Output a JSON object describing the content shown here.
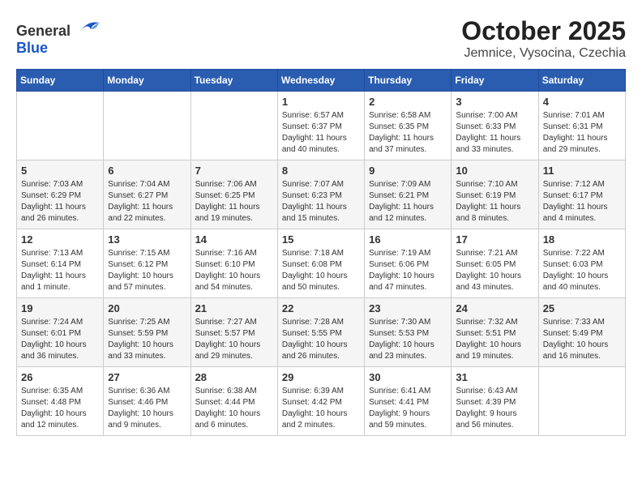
{
  "header": {
    "logo_general": "General",
    "logo_blue": "Blue",
    "month_title": "October 2025",
    "subtitle": "Jemnice, Vysocina, Czechia"
  },
  "weekdays": [
    "Sunday",
    "Monday",
    "Tuesday",
    "Wednesday",
    "Thursday",
    "Friday",
    "Saturday"
  ],
  "rows": [
    [
      {
        "day": "",
        "info": ""
      },
      {
        "day": "",
        "info": ""
      },
      {
        "day": "",
        "info": ""
      },
      {
        "day": "1",
        "info": "Sunrise: 6:57 AM\nSunset: 6:37 PM\nDaylight: 11 hours\nand 40 minutes."
      },
      {
        "day": "2",
        "info": "Sunrise: 6:58 AM\nSunset: 6:35 PM\nDaylight: 11 hours\nand 37 minutes."
      },
      {
        "day": "3",
        "info": "Sunrise: 7:00 AM\nSunset: 6:33 PM\nDaylight: 11 hours\nand 33 minutes."
      },
      {
        "day": "4",
        "info": "Sunrise: 7:01 AM\nSunset: 6:31 PM\nDaylight: 11 hours\nand 29 minutes."
      }
    ],
    [
      {
        "day": "5",
        "info": "Sunrise: 7:03 AM\nSunset: 6:29 PM\nDaylight: 11 hours\nand 26 minutes."
      },
      {
        "day": "6",
        "info": "Sunrise: 7:04 AM\nSunset: 6:27 PM\nDaylight: 11 hours\nand 22 minutes."
      },
      {
        "day": "7",
        "info": "Sunrise: 7:06 AM\nSunset: 6:25 PM\nDaylight: 11 hours\nand 19 minutes."
      },
      {
        "day": "8",
        "info": "Sunrise: 7:07 AM\nSunset: 6:23 PM\nDaylight: 11 hours\nand 15 minutes."
      },
      {
        "day": "9",
        "info": "Sunrise: 7:09 AM\nSunset: 6:21 PM\nDaylight: 11 hours\nand 12 minutes."
      },
      {
        "day": "10",
        "info": "Sunrise: 7:10 AM\nSunset: 6:19 PM\nDaylight: 11 hours\nand 8 minutes."
      },
      {
        "day": "11",
        "info": "Sunrise: 7:12 AM\nSunset: 6:17 PM\nDaylight: 11 hours\nand 4 minutes."
      }
    ],
    [
      {
        "day": "12",
        "info": "Sunrise: 7:13 AM\nSunset: 6:14 PM\nDaylight: 11 hours\nand 1 minute."
      },
      {
        "day": "13",
        "info": "Sunrise: 7:15 AM\nSunset: 6:12 PM\nDaylight: 10 hours\nand 57 minutes."
      },
      {
        "day": "14",
        "info": "Sunrise: 7:16 AM\nSunset: 6:10 PM\nDaylight: 10 hours\nand 54 minutes."
      },
      {
        "day": "15",
        "info": "Sunrise: 7:18 AM\nSunset: 6:08 PM\nDaylight: 10 hours\nand 50 minutes."
      },
      {
        "day": "16",
        "info": "Sunrise: 7:19 AM\nSunset: 6:06 PM\nDaylight: 10 hours\nand 47 minutes."
      },
      {
        "day": "17",
        "info": "Sunrise: 7:21 AM\nSunset: 6:05 PM\nDaylight: 10 hours\nand 43 minutes."
      },
      {
        "day": "18",
        "info": "Sunrise: 7:22 AM\nSunset: 6:03 PM\nDaylight: 10 hours\nand 40 minutes."
      }
    ],
    [
      {
        "day": "19",
        "info": "Sunrise: 7:24 AM\nSunset: 6:01 PM\nDaylight: 10 hours\nand 36 minutes."
      },
      {
        "day": "20",
        "info": "Sunrise: 7:25 AM\nSunset: 5:59 PM\nDaylight: 10 hours\nand 33 minutes."
      },
      {
        "day": "21",
        "info": "Sunrise: 7:27 AM\nSunset: 5:57 PM\nDaylight: 10 hours\nand 29 minutes."
      },
      {
        "day": "22",
        "info": "Sunrise: 7:28 AM\nSunset: 5:55 PM\nDaylight: 10 hours\nand 26 minutes."
      },
      {
        "day": "23",
        "info": "Sunrise: 7:30 AM\nSunset: 5:53 PM\nDaylight: 10 hours\nand 23 minutes."
      },
      {
        "day": "24",
        "info": "Sunrise: 7:32 AM\nSunset: 5:51 PM\nDaylight: 10 hours\nand 19 minutes."
      },
      {
        "day": "25",
        "info": "Sunrise: 7:33 AM\nSunset: 5:49 PM\nDaylight: 10 hours\nand 16 minutes."
      }
    ],
    [
      {
        "day": "26",
        "info": "Sunrise: 6:35 AM\nSunset: 4:48 PM\nDaylight: 10 hours\nand 12 minutes."
      },
      {
        "day": "27",
        "info": "Sunrise: 6:36 AM\nSunset: 4:46 PM\nDaylight: 10 hours\nand 9 minutes."
      },
      {
        "day": "28",
        "info": "Sunrise: 6:38 AM\nSunset: 4:44 PM\nDaylight: 10 hours\nand 6 minutes."
      },
      {
        "day": "29",
        "info": "Sunrise: 6:39 AM\nSunset: 4:42 PM\nDaylight: 10 hours\nand 2 minutes."
      },
      {
        "day": "30",
        "info": "Sunrise: 6:41 AM\nSunset: 4:41 PM\nDaylight: 9 hours\nand 59 minutes."
      },
      {
        "day": "31",
        "info": "Sunrise: 6:43 AM\nSunset: 4:39 PM\nDaylight: 9 hours\nand 56 minutes."
      },
      {
        "day": "",
        "info": ""
      }
    ]
  ]
}
